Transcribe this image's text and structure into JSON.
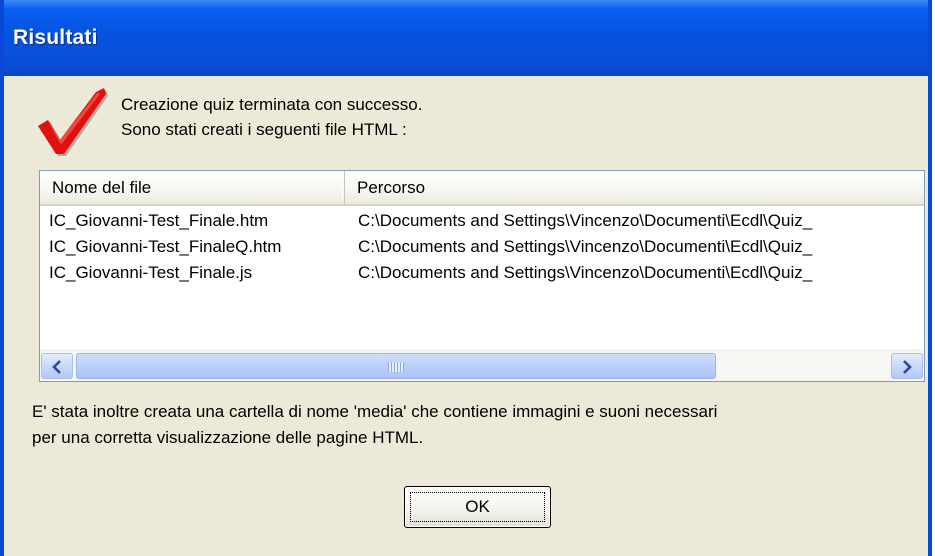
{
  "window": {
    "title": "Risultati"
  },
  "message": {
    "line1": "Creazione quiz terminata con successo.",
    "line2": "Sono stati creati i seguenti file HTML :",
    "icon": "red-checkmark-icon"
  },
  "file_list": {
    "columns": [
      "Nome del file",
      "Percorso"
    ],
    "rows": [
      [
        "IC_Giovanni-Test_Finale.htm",
        "C:\\Documents and Settings\\Vincenzo\\Documenti\\Ecdl\\Quiz_"
      ],
      [
        "IC_Giovanni-Test_FinaleQ.htm",
        "C:\\Documents and Settings\\Vincenzo\\Documenti\\Ecdl\\Quiz_"
      ],
      [
        "IC_Giovanni-Test_Finale.js",
        "C:\\Documents and Settings\\Vincenzo\\Documenti\\Ecdl\\Quiz_"
      ]
    ]
  },
  "info": {
    "line1": "E' stata inoltre creata una cartella di nome 'media' che contiene immagini e suoni necessari",
    "line2": "per una corretta visualizzazione delle pagine HTML."
  },
  "buttons": {
    "ok_label": "OK"
  },
  "colors": {
    "titlebar": "#0553e0",
    "dialog_bg": "#ece9d8",
    "checkmark": "#e01010"
  }
}
